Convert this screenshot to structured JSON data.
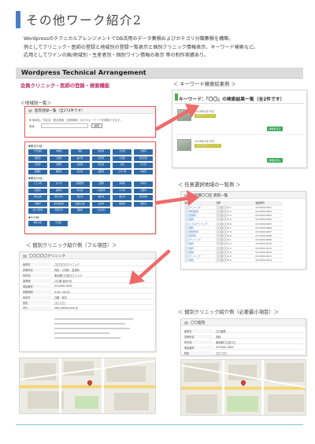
{
  "title": "その他ワーク紹介2",
  "intro": [
    "WordpressのテクニカルアレンジメントでDB活用のデータ集積およびカテゴリ分類集積を構築。",
    "例としてクリニック・医師の登録と地域別の登録一覧表示と個別クリニック情報表示、キーワード検索など。",
    "応用としてワインの国/地域別・生産者別・個別ワイン情報の表示 等の制作実績あり。"
  ],
  "section_title": "Wordpress Technical Arrangement",
  "left_col": {
    "main_title": "会員クリニック・医師の登録・検索機能",
    "area_list_title": "＜地域別一覧＞",
    "clinic_title": "＜ 個別クリニック紹介例（フル項目）＞",
    "screen": {
      "header": "医院登録一覧（全272件です）",
      "search_note": "▼ 地域名、市区名、駅名検索（全角検索）などのキーワードを検索できます。",
      "search_label": "検索",
      "search_button": "検索",
      "group_labels": [
        "▼東京23区",
        "▼東京23区",
        "▼その他"
      ],
      "group1": [
        "千代田区",
        "中央区",
        "港区",
        "新宿区",
        "文京区",
        "台東区",
        "墨田区",
        "江東区",
        "品川区",
        "目黒区",
        "大田区",
        "世田谷区",
        "渋谷区",
        "中野区",
        "杉並区",
        "豊島区",
        "北区",
        "荒川区",
        "板橋区",
        "練馬区",
        "足立区",
        "葛飾区",
        "江戸川区",
        "中央区"
      ],
      "group2": [
        "八王子市",
        "立川市",
        "武蔵野市",
        "三鷹市",
        "青梅市",
        "府中市",
        "昭島市",
        "調布市",
        "町田市",
        "小金井市",
        "小平市",
        "日野市",
        "東村山市",
        "国分寺市",
        "国立市",
        "福生市",
        "狛江市",
        "東大和市",
        "清瀬市",
        "東久留米市",
        "武蔵村山市",
        "多摩市",
        "稲城市",
        "羽村市",
        "あきる野市",
        "西東京市",
        "瑞穂町",
        "日の出町"
      ],
      "group3": [
        "神奈川県",
        "埼玉県"
      ]
    },
    "detail": {
      "header": "〇〇〇〇〇クリニック",
      "rows": [
        {
          "k": "医院名",
          "v": "〇〇〇〇〇クリニック"
        },
        {
          "k": "診療科目",
          "v": "内科・小児科・皮膚科"
        },
        {
          "k": "所在地",
          "v": "東京都〇〇区〇〇 1-2-3"
        },
        {
          "k": "最寄駅",
          "v": "〇〇駅 徒歩3分"
        },
        {
          "k": "電話番号",
          "v": "03-0000-0000"
        },
        {
          "k": "診療時間",
          "v": "9:00～18:00"
        },
        {
          "k": "休診日",
          "v": "日曜・祝日"
        },
        {
          "k": "院長",
          "v": "〇〇 〇〇"
        },
        {
          "k": "URL",
          "v": "http://www.xxxx.jp"
        },
        {
          "k": "備考",
          "v": "〇〇〇〇〇〇〇〇〇〇〇〇"
        }
      ]
    }
  },
  "right_col": {
    "keyword_title": "＜ キーワード検索結果例 ＞",
    "keyword_screen_title": "キーワード：「〇〇」の検索結果一覧（全2件です）",
    "results": [
      {
        "date": "2016年3月25日",
        "name": "〇〇クリニック",
        "button": "詳細を見る"
      },
      {
        "date": "2016年3月25日",
        "name": "〇〇〇〇クリニック",
        "button": "詳細を見る"
      }
    ],
    "area_title": "＜ 任意選択地域の一覧例 ＞",
    "area_header": "東京都〇〇区 病院一覧",
    "area_columns": [
      "医院名",
      "住所",
      "電話番号"
    ],
    "area_rows": [
      [
        "〇〇クリニック",
        "〇〇区〇〇1-1",
        "03-0000-0001"
      ],
      [
        "〇〇内科医院",
        "〇〇区〇〇2-3",
        "03-0000-0002"
      ],
      [
        "〇〇皮膚科",
        "〇〇区〇〇3-4",
        "03-0000-0003"
      ],
      [
        "〇〇医院",
        "〇〇区〇〇4-5",
        "03-0000-0004"
      ],
      [
        "〇〇こどもクリニック",
        "〇〇区〇〇5-6",
        "03-0000-0005"
      ],
      [
        "〇〇眼科",
        "〇〇区〇〇6-7",
        "03-0000-0006"
      ],
      [
        "〇〇整形外科",
        "〇〇区〇〇7-8",
        "03-0000-0007"
      ],
      [
        "〇〇耳鼻科",
        "〇〇区〇〇8-9",
        "03-0000-0008"
      ],
      [
        "〇〇クリニック",
        "〇〇区〇〇9-1",
        "03-0000-0009"
      ],
      [
        "〇〇歯科",
        "〇〇区〇〇1-2",
        "03-0000-0010"
      ],
      [
        "〇〇内科",
        "〇〇区〇〇2-3",
        "03-0000-0011"
      ],
      [
        "〇〇医院",
        "〇〇区〇〇3-4",
        "03-0000-0012"
      ],
      [
        "〇〇クリニック",
        "〇〇区〇〇4-5",
        "03-0000-0013"
      ],
      [
        "〇〇病院",
        "〇〇区〇〇5-6",
        "03-0000-0014"
      ]
    ],
    "clinic_title": "＜ 個別クリニック紹介例（必要最小項目）＞",
    "clinic_header": "〇〇医院",
    "clinic_rows": [
      {
        "k": "医院名",
        "v": "〇〇医院"
      },
      {
        "k": "診療科目",
        "v": "内科"
      },
      {
        "k": "所在地",
        "v": "東京都〇〇区〇〇"
      },
      {
        "k": "電話番号",
        "v": "03-0000-0000"
      },
      {
        "k": "院長",
        "v": "〇〇 〇〇"
      }
    ]
  },
  "colors": {
    "accent": "#4a7fc8",
    "pink": "#c0306a",
    "button_blue": "#2f6aa8",
    "green": "#3bab5a",
    "arrow": "#ee6b6b"
  }
}
